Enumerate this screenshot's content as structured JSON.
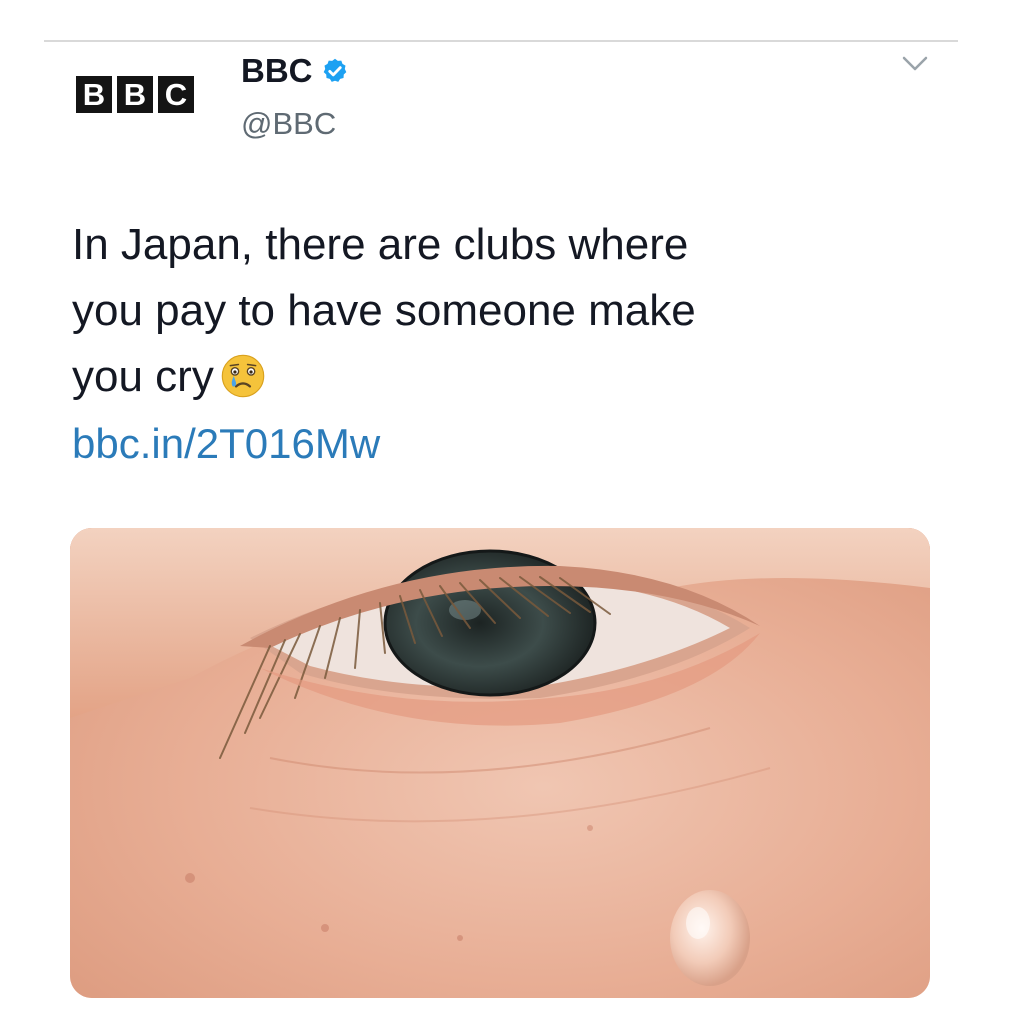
{
  "account": {
    "logo_letters": [
      "B",
      "B",
      "C"
    ],
    "display_name": "BBC",
    "handle": "@BBC",
    "verified": true
  },
  "tweet": {
    "text_lines": [
      "In Japan, there are clubs where",
      "you pay to have someone make",
      "you cry"
    ],
    "emoji": "crying-face",
    "link": "bbc.in/2T016Mw"
  },
  "media": {
    "subject": "close-up-eye-with-tear"
  },
  "icons": {
    "verified": "verified-badge-icon",
    "menu": "chevron-down-icon"
  },
  "colors": {
    "text": "#141823",
    "handle": "#5f6a73",
    "link": "#2b7bb9",
    "verified": "#1da1f2"
  }
}
